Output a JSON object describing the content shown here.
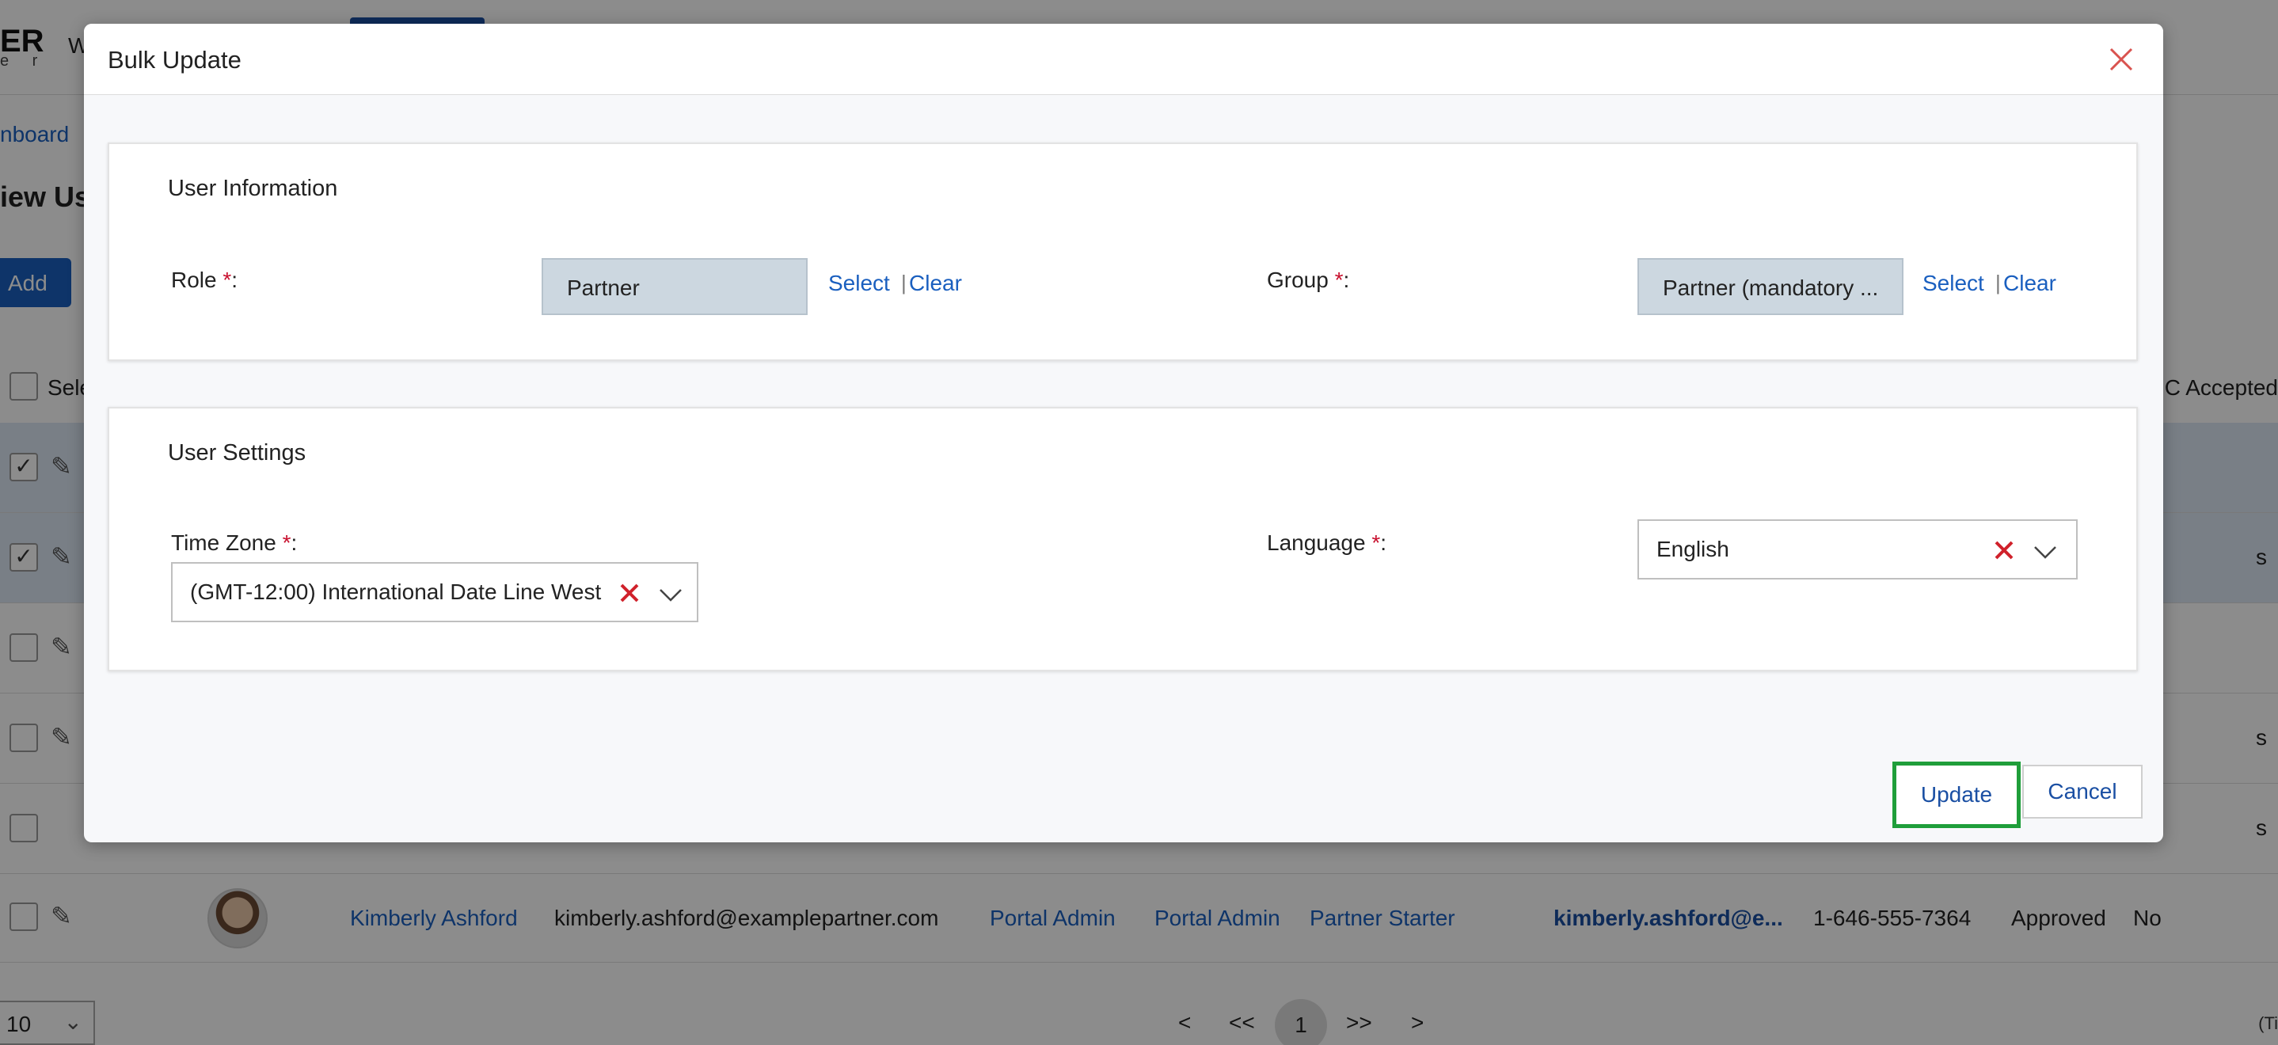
{
  "background": {
    "logo_big": "ER",
    "logo_small": "e r",
    "nav_item": "W",
    "breadcrumb": "nboard",
    "page_title": "iew Use",
    "add_button": "Add",
    "select_header": "Sele",
    "tc_header": "C Accepted",
    "row_tails": [
      "s",
      "s",
      "s"
    ],
    "last_row": {
      "name": "Kimberly Ashford",
      "email": "kimberly.ashford@examplepartner.com",
      "role1": "Portal Admin",
      "role2": "Portal Admin",
      "group": "Partner Starter",
      "username": "kimberly.ashford@e...",
      "phone": "1-646-555-7364",
      "status": "Approved",
      "tc": "No"
    },
    "pager": {
      "page_size": "10",
      "prev": "<",
      "first": "<<",
      "current": "1",
      "last": ">>",
      "next": ">",
      "note": "(Ti"
    }
  },
  "modal": {
    "title": "Bulk Update",
    "user_information": {
      "title": "User Information",
      "role_label": "Role",
      "role_value": "Partner",
      "group_label": "Group",
      "group_value": "Partner (mandatory ...",
      "select_label": "Select",
      "clear_label": "Clear",
      "separator": "|",
      "required_mark": "*",
      "colon": ":"
    },
    "user_settings": {
      "title": "User Settings",
      "timezone_label": "Time Zone",
      "timezone_value": "(GMT-12:00) International Date Line West",
      "language_label": "Language",
      "language_value": "English"
    },
    "update_button": "Update",
    "cancel_button": "Cancel"
  },
  "colors": {
    "accent": "#1a5fbf",
    "required": "#c8102e",
    "focus_outline": "#1f9e3a",
    "readonly_fill": "#ccd7e0"
  }
}
